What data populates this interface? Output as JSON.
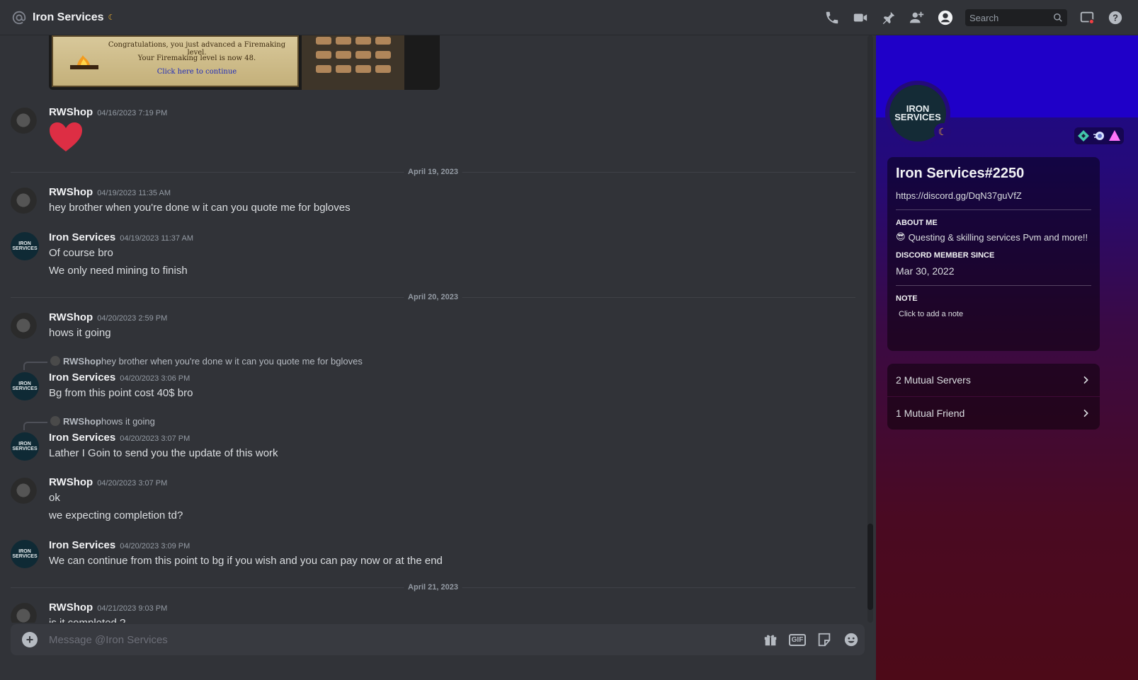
{
  "header": {
    "title": "Iron Services",
    "search_placeholder": "Search"
  },
  "embed": {
    "line1": "Congratulations, you just advanced a Firemaking level.",
    "line2": "Your Firemaking level is now 48.",
    "line3": "Click here to continue"
  },
  "dividers": [
    "April 19, 2023",
    "April 20, 2023",
    "April 21, 2023"
  ],
  "messages": [
    {
      "author": "RWShop",
      "time": "04/16/2023 7:19 PM"
    },
    {
      "author": "RWShop",
      "time": "04/19/2023 11:35 AM",
      "lines": [
        "hey brother when you're done w it can you quote me for bgloves"
      ]
    },
    {
      "author": "Iron Services",
      "time": "04/19/2023 11:37 AM",
      "lines": [
        "Of course bro",
        "We only need mining to finish"
      ]
    },
    {
      "author": "RWShop",
      "time": "04/20/2023 2:59 PM",
      "lines": [
        "hows it going"
      ]
    },
    {
      "author": "Iron Services",
      "time": "04/20/2023 3:06 PM",
      "reply_author": "RWShop",
      "reply_text": "hey brother when you're done w it can you quote me for bgloves",
      "lines": [
        "Bg from this point cost 40$ bro"
      ]
    },
    {
      "author": "Iron Services",
      "time": "04/20/2023 3:07 PM",
      "reply_author": "RWShop",
      "reply_text": "hows it going",
      "lines": [
        "Lather I Goin to send you the update of this work"
      ]
    },
    {
      "author": "RWShop",
      "time": "04/20/2023 3:07 PM",
      "lines": [
        "ok",
        "we expecting completion td?"
      ]
    },
    {
      "author": "Iron Services",
      "time": "04/20/2023 3:09 PM",
      "lines": [
        "We can continue from this point to bg if you wish and you can pay now or at the end"
      ]
    },
    {
      "author": "RWShop",
      "time": "04/21/2023 9:03 PM",
      "lines": [
        "is it completed ?"
      ]
    }
  ],
  "composer": {
    "placeholder": "Message @Iron Services"
  },
  "profile": {
    "avatar_text": "IRON SERVICES",
    "username": "Iron Services#2250",
    "link": "https://discord.gg/DqN37guVfZ",
    "about_heading": "ABOUT ME",
    "about_emoji": "😎",
    "about_text": "Questing & skilling services Pvm and more!!",
    "since_heading": "DISCORD MEMBER SINCE",
    "since_value": "Mar 30, 2022",
    "note_heading": "NOTE",
    "note_placeholder": "Click to add a note",
    "mutual_servers": "2 Mutual Servers",
    "mutual_friends": "1 Mutual Friend"
  },
  "colors": {
    "background": "#313338",
    "banner": "#1f00c8",
    "accent_heart": "#dd2e44",
    "idle_moon": "#f0b232"
  }
}
